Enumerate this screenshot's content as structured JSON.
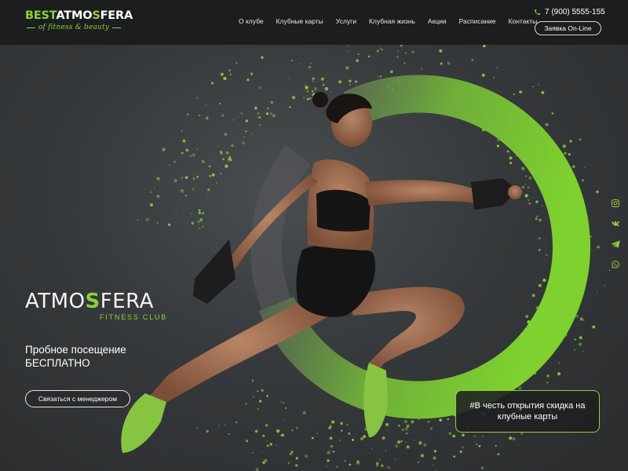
{
  "header": {
    "logo": {
      "main_green": "BEST",
      "main_white": "ATMO",
      "main_green2": "S",
      "main_white2": "FERA",
      "tagline": "of fitness & beauty"
    },
    "nav": [
      "О клубе",
      "Клубные карты",
      "Услуги",
      "Клубная жизнь",
      "Акции",
      "Расписание",
      "Контакты"
    ],
    "phone": "7 (900) 5555-155",
    "online_button": "Заявка On-Line"
  },
  "hero": {
    "brand": {
      "name_part1": "ATMO",
      "name_s": "S",
      "name_part2": "FERA",
      "subtitle": "FITNESS CLUB"
    },
    "trial_line1": "Пробное посещение",
    "trial_line2": "БЕСПЛАТНО",
    "contact_button": "Связаться с менеджером",
    "promo": "#В честь открытия скидка на клубные карты"
  },
  "social": [
    "instagram-icon",
    "vk-icon",
    "telegram-icon",
    "whatsapp-icon"
  ],
  "colors": {
    "accent": "#8cd13a",
    "header_bg": "#1c1d1f",
    "hero_bg": "#36393b"
  }
}
